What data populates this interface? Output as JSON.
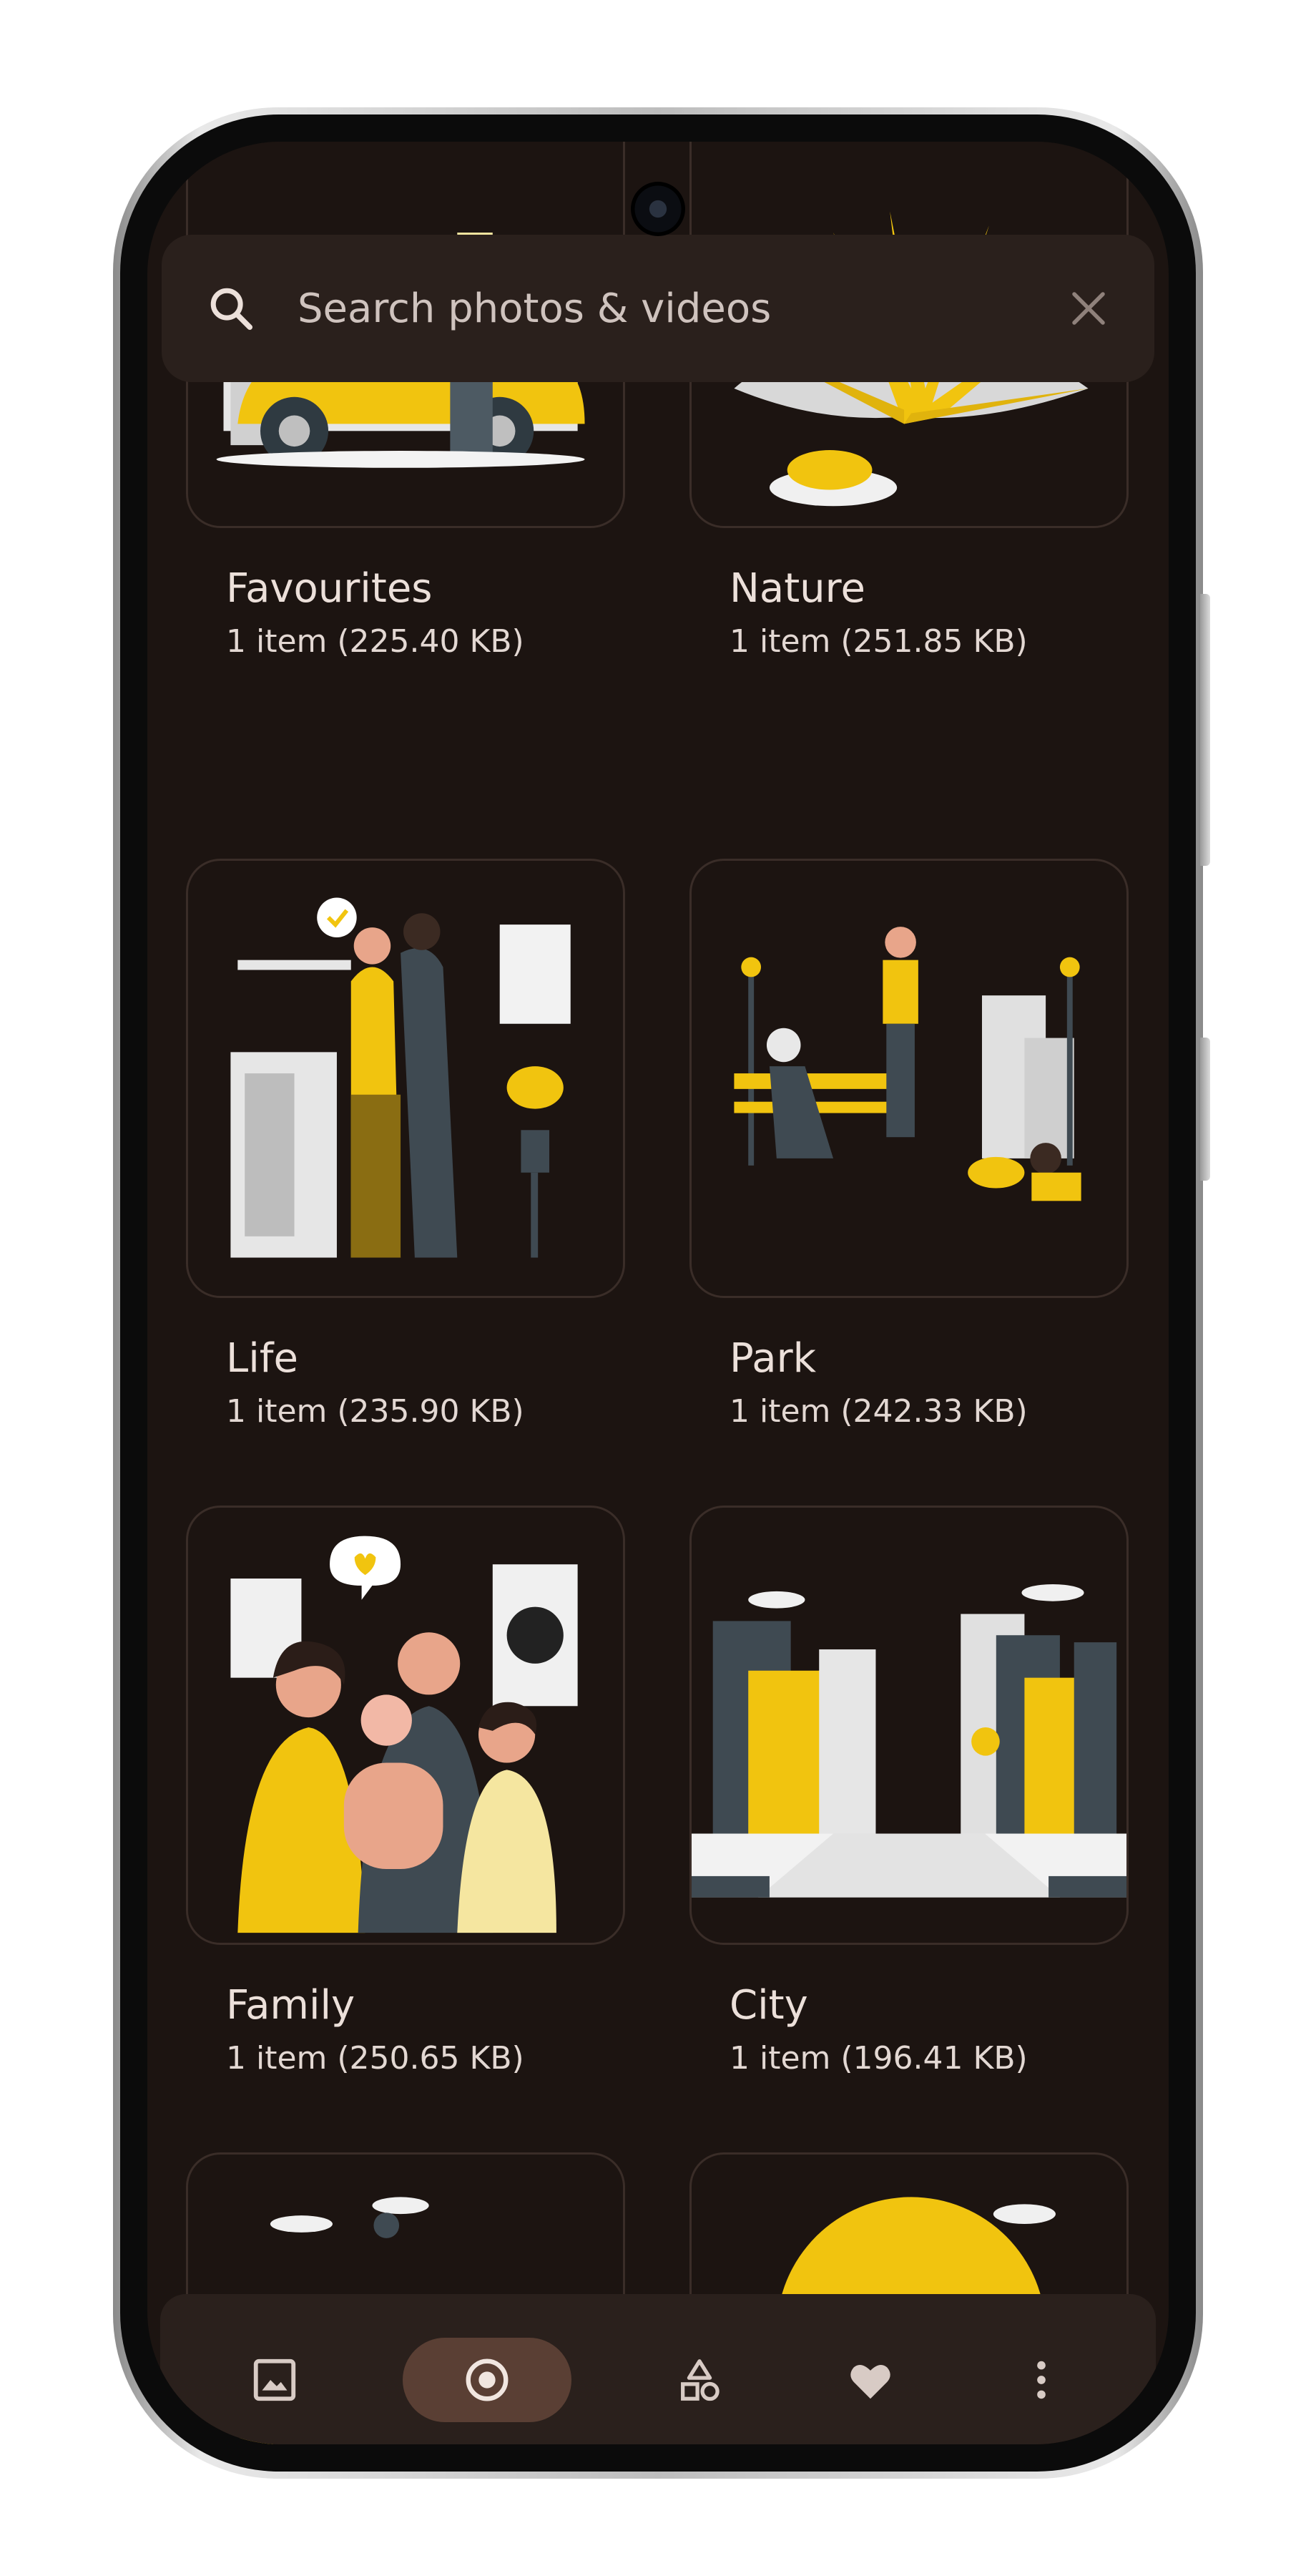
{
  "search": {
    "placeholder": "Search photos & videos"
  },
  "albums": [
    {
      "name": "Favourites",
      "meta": "1 item (225.40 KB)"
    },
    {
      "name": "Nature",
      "meta": "1 item (251.85 KB)"
    },
    {
      "name": "Life",
      "meta": "1 item (235.90 KB)"
    },
    {
      "name": "Park",
      "meta": "1 item (242.33 KB)"
    },
    {
      "name": "Family",
      "meta": "1 item (250.65 KB)"
    },
    {
      "name": "City",
      "meta": "1 item (196.41 KB)"
    }
  ],
  "bottom_nav": {
    "items": [
      {
        "icon": "image-icon",
        "active": false
      },
      {
        "icon": "albums-target-icon",
        "active": true
      },
      {
        "icon": "shapes-icon",
        "active": false
      },
      {
        "icon": "heart-icon",
        "active": false
      },
      {
        "icon": "more-vertical-icon",
        "active": false
      }
    ]
  },
  "colors": {
    "background": "#1c1411",
    "surface": "#2a201c",
    "accent": "#f5c518",
    "active_pill": "#5a3f34",
    "text": "#ece0da"
  }
}
